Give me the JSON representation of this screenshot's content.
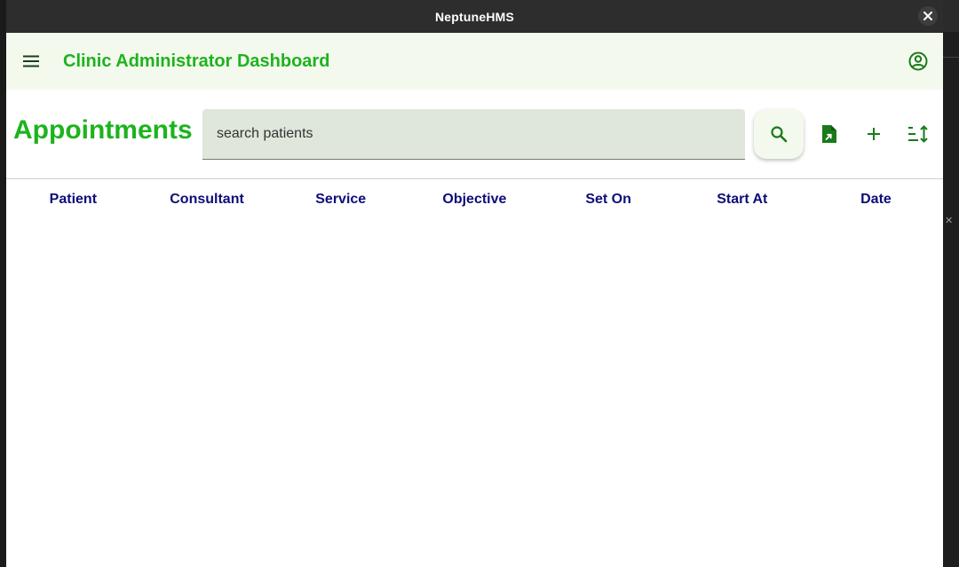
{
  "window": {
    "title": "NeptuneHMS"
  },
  "appbar": {
    "title": "Clinic Administrator Dashboard"
  },
  "page": {
    "title": "Appointments",
    "search": {
      "placeholder": "search patients",
      "value": ""
    }
  },
  "table": {
    "columns": [
      "Patient",
      "Consultant",
      "Service",
      "Objective",
      "Set On",
      "Start At",
      "Date"
    ],
    "rows": []
  },
  "colors": {
    "accent": "#1db31d",
    "header_text": "#0d0d7a",
    "appbar_bg": "#f4f9ee",
    "search_bg": "#dfe6da",
    "icon_green": "#1a7a1a"
  },
  "icons": {
    "menu": "hamburger-icon",
    "account": "account-circle-icon",
    "search": "search-icon",
    "export": "file-export-icon",
    "add": "plus-icon",
    "sort": "sort-icon",
    "close": "close-icon"
  }
}
